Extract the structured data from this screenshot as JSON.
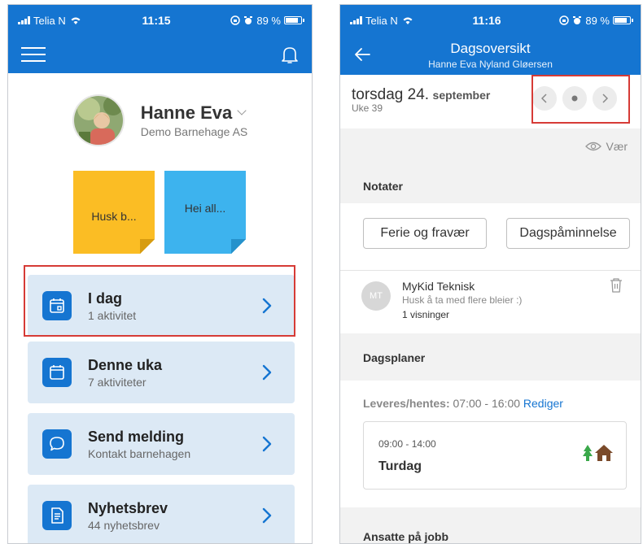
{
  "left_phone": {
    "status": {
      "carrier": "Telia N",
      "time": "11:15",
      "battery": "89 %"
    },
    "profile": {
      "name": "Hanne Eva",
      "org": "Demo Barnehage AS"
    },
    "notes": [
      {
        "text": "Husk b...",
        "color": "#fbbd24"
      },
      {
        "text": "Hei all...",
        "color": "#3db3ee"
      }
    ],
    "menu": [
      {
        "title": "I dag",
        "subtitle": "1 aktivitet",
        "icon": "calendar-day-icon"
      },
      {
        "title": "Denne uka",
        "subtitle": "7 aktiviteter",
        "icon": "calendar-icon"
      },
      {
        "title": "Send melding",
        "subtitle": "Kontakt barnehagen",
        "icon": "chat-bubble-icon"
      },
      {
        "title": "Nyhetsbrev",
        "subtitle": "44 nyhetsbrev",
        "icon": "newsletter-icon"
      }
    ]
  },
  "right_phone": {
    "status": {
      "carrier": "Telia N",
      "time": "11:16",
      "battery": "89 %"
    },
    "header": {
      "title": "Dagsoversikt",
      "subtitle": "Hanne Eva Nyland Gløersen"
    },
    "date": {
      "day": "torsdag 24.",
      "month": "september",
      "week": "Uke 39"
    },
    "weather_label": "Vær",
    "notes_section": {
      "title": "Notater",
      "buttons": [
        "Ferie og fravær",
        "Dagspåminnelse"
      ]
    },
    "message": {
      "initials": "MT",
      "author": "MyKid Teknisk",
      "text": "Husk å ta med flere bleier :)",
      "views": "1 visninger"
    },
    "day_plans": {
      "title": "Dagsplaner",
      "delivery_label": "Leveres/hentes:",
      "delivery_time": "07:00 - 16:00",
      "edit": "Rediger",
      "plan_time": "09:00 - 14:00",
      "plan_title": "Turdag"
    },
    "staff_section": {
      "title": "Ansatte på jobb"
    }
  },
  "colors": {
    "brand": "#1575d1",
    "card_bg": "#dce9f5",
    "highlight": "#d63b36",
    "link": "#1575d1"
  }
}
